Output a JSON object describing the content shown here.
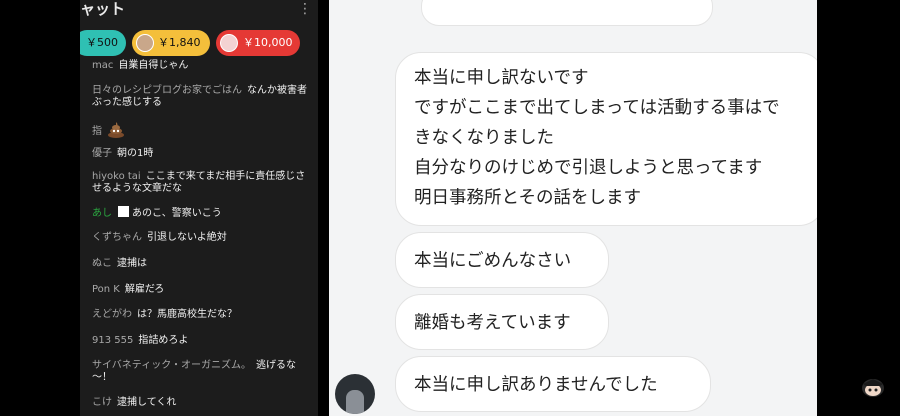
{
  "chat": {
    "title": "ャット",
    "menu_icon": "more-vertical-icon",
    "tickers": [
      {
        "amount": "￥500",
        "color": "#2fc0b3"
      },
      {
        "amount": "￥1,840",
        "color": "#f4bf3b"
      },
      {
        "amount": "￥10,000",
        "color": "#e53935"
      }
    ],
    "messages": [
      {
        "author": "mac",
        "text": "自業自得じゃん"
      },
      {
        "author": "日々のレシピブログお家でごはん",
        "text": "なんか被害者ぶった感じする"
      },
      {
        "author": "指",
        "text": ""
      },
      {
        "author": "優子",
        "text": "朝の1時"
      },
      {
        "author": "hiyoko tai",
        "text": "ここまで来てまだ相手に責任感じさせるような文章だな"
      },
      {
        "author": "あし",
        "text": "あのこ、警察いこう"
      },
      {
        "author": "くずちゃん",
        "text": "引退しないよ絶対"
      },
      {
        "author": "ぬこ",
        "text": "逮捕は"
      },
      {
        "author": "Pon K",
        "text": "解雇だろ"
      },
      {
        "author": "えどがわ",
        "text": "は？馬鹿高校生だな？"
      },
      {
        "author": "913 555",
        "text": "指詰めろよ"
      },
      {
        "author": "サイバネティック・オーガニズム。",
        "text": "逃げるな～！"
      },
      {
        "author": "こけ",
        "text": "逮捕してくれ"
      }
    ]
  },
  "conversation": {
    "bubble1": [
      "本当に申し訳ないです",
      "ですがここまで出てしまっては活動する事はで",
      "きなくなりました",
      "自分なりのけじめで引退しようと思ってます",
      "明日事務所とその話をします"
    ],
    "bubble2": "本当にごめんなさい",
    "bubble3": "離婚も考えています",
    "bubble4": "本当に申し訳ありませんでした"
  }
}
